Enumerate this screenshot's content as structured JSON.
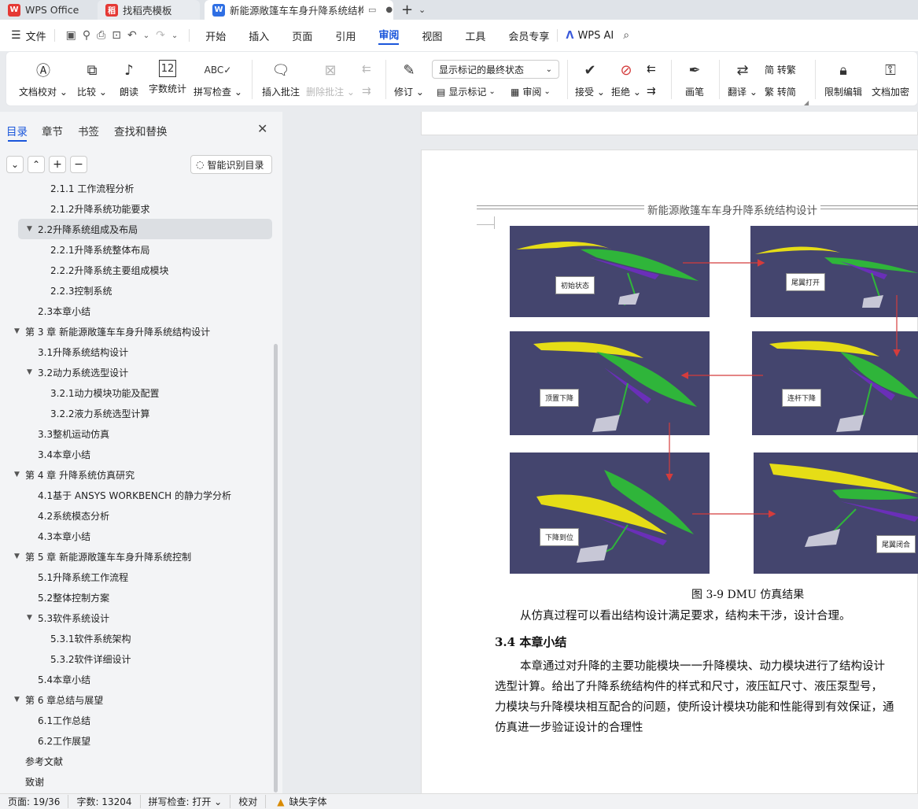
{
  "tabs": {
    "wps": "WPS Office",
    "template": "找稻壳模板",
    "doc": "新能源敞篷车车身升降系统结构设计 毕"
  },
  "menu": {
    "file": "文件",
    "items": [
      "开始",
      "插入",
      "页面",
      "引用",
      "审阅",
      "视图",
      "工具",
      "会员专享"
    ],
    "ai": "WPS AI"
  },
  "ribbon": {
    "doc_check": "文档校对",
    "compare": "比较",
    "read": "朗读",
    "word_count": "字数统计",
    "spell_check": "拼写检查",
    "insert_comment": "插入批注",
    "delete_comment": "删除批注",
    "track": "修订",
    "markup_select": "显示标记的最终状态",
    "show_markup": "显示标记",
    "review": "审阅",
    "accept": "接受",
    "reject": "拒绝",
    "pen": "画笔",
    "translate": "翻译",
    "to_simplified": "简 转繁",
    "to_traditional": "繁 转简",
    "restrict_edit": "限制编辑",
    "doc_encrypt": "文档加密"
  },
  "panel": {
    "tabs": [
      "目录",
      "章节",
      "书签",
      "查找和替换"
    ],
    "smart_toc": "智能识别目录",
    "toc": [
      {
        "text": "2.1.1 工作流程分析",
        "level": 3
      },
      {
        "text": "2.1.2升降系统功能要求",
        "level": 3
      },
      {
        "text": "2.2升降系统组成及布局",
        "level": 2,
        "expand": true,
        "selected": true
      },
      {
        "text": "2.2.1升降系统整体布局",
        "level": 3
      },
      {
        "text": "2.2.2升降系统主要组成模块",
        "level": 3
      },
      {
        "text": "2.2.3控制系统",
        "level": 3
      },
      {
        "text": "2.3本章小结",
        "level": 2
      },
      {
        "text": "第 3 章 新能源敞篷车车身升降系统结构设计",
        "level": 1,
        "expand": true
      },
      {
        "text": "3.1升降系统结构设计",
        "level": 2
      },
      {
        "text": "3.2动力系统选型设计",
        "level": 2,
        "expand": true
      },
      {
        "text": "3.2.1动力模块功能及配置",
        "level": 3
      },
      {
        "text": "3.2.2液力系统选型计算",
        "level": 3
      },
      {
        "text": "3.3整机运动仿真",
        "level": 2
      },
      {
        "text": "3.4本章小结",
        "level": 2
      },
      {
        "text": "第 4 章 升降系统仿真研究",
        "level": 1,
        "expand": true
      },
      {
        "text": "4.1基于 ANSYS WORKBENCH 的静力学分析",
        "level": 2
      },
      {
        "text": "4.2系统模态分析",
        "level": 2
      },
      {
        "text": "4.3本章小结",
        "level": 2
      },
      {
        "text": "第 5 章 新能源敞篷车车身升降系统控制",
        "level": 1,
        "expand": true
      },
      {
        "text": "5.1升降系统工作流程",
        "level": 2
      },
      {
        "text": "5.2整体控制方案",
        "level": 2
      },
      {
        "text": "5.3软件系统设计",
        "level": 2,
        "expand": true
      },
      {
        "text": "5.3.1软件系统架构",
        "level": 3
      },
      {
        "text": "5.3.2软件详细设计",
        "level": 3
      },
      {
        "text": "5.4本章小结",
        "level": 2
      },
      {
        "text": "第 6 章总结与展望",
        "level": 1,
        "expand": true
      },
      {
        "text": "6.1工作总结",
        "level": 2
      },
      {
        "text": "6.2工作展望",
        "level": 2
      },
      {
        "text": "参考文献",
        "level": 1
      },
      {
        "text": "致谢",
        "level": 1
      }
    ]
  },
  "document": {
    "header": "新能源敞篷车车身升降系统结构设计",
    "figure_labels": [
      "初始状态",
      "尾翼打开",
      "顶置下降",
      "连杆下降",
      "下降到位",
      "尾翼闭合"
    ],
    "caption": "图 3-9 DMU 仿真结果",
    "para1": "从仿真过程可以看出结构设计满足要求，结构未干涉，设计合理。",
    "heading": "3.4  本章小结",
    "para2_lines": [
      "本章通过对升降的主要功能模块一一升降模块、动力模块进行了结构设计",
      "选型计算。给出了升降系统结构件的样式和尺寸，液压缸尺寸、液压泵型号，",
      "力模块与升降模块相互配合的问题，使所设计模块功能和性能得到有效保证，通",
      "仿真进一步验证设计的合理性"
    ]
  },
  "status": {
    "page": "页面: 19/36",
    "words": "字数: 13204",
    "spell": "拼写检查: 打开",
    "proof": "校对",
    "missing_font": "缺失字体"
  },
  "colors": {
    "accent": "#1a56db",
    "figure_bg": "#44456e",
    "arrow": "#d43c3c"
  }
}
